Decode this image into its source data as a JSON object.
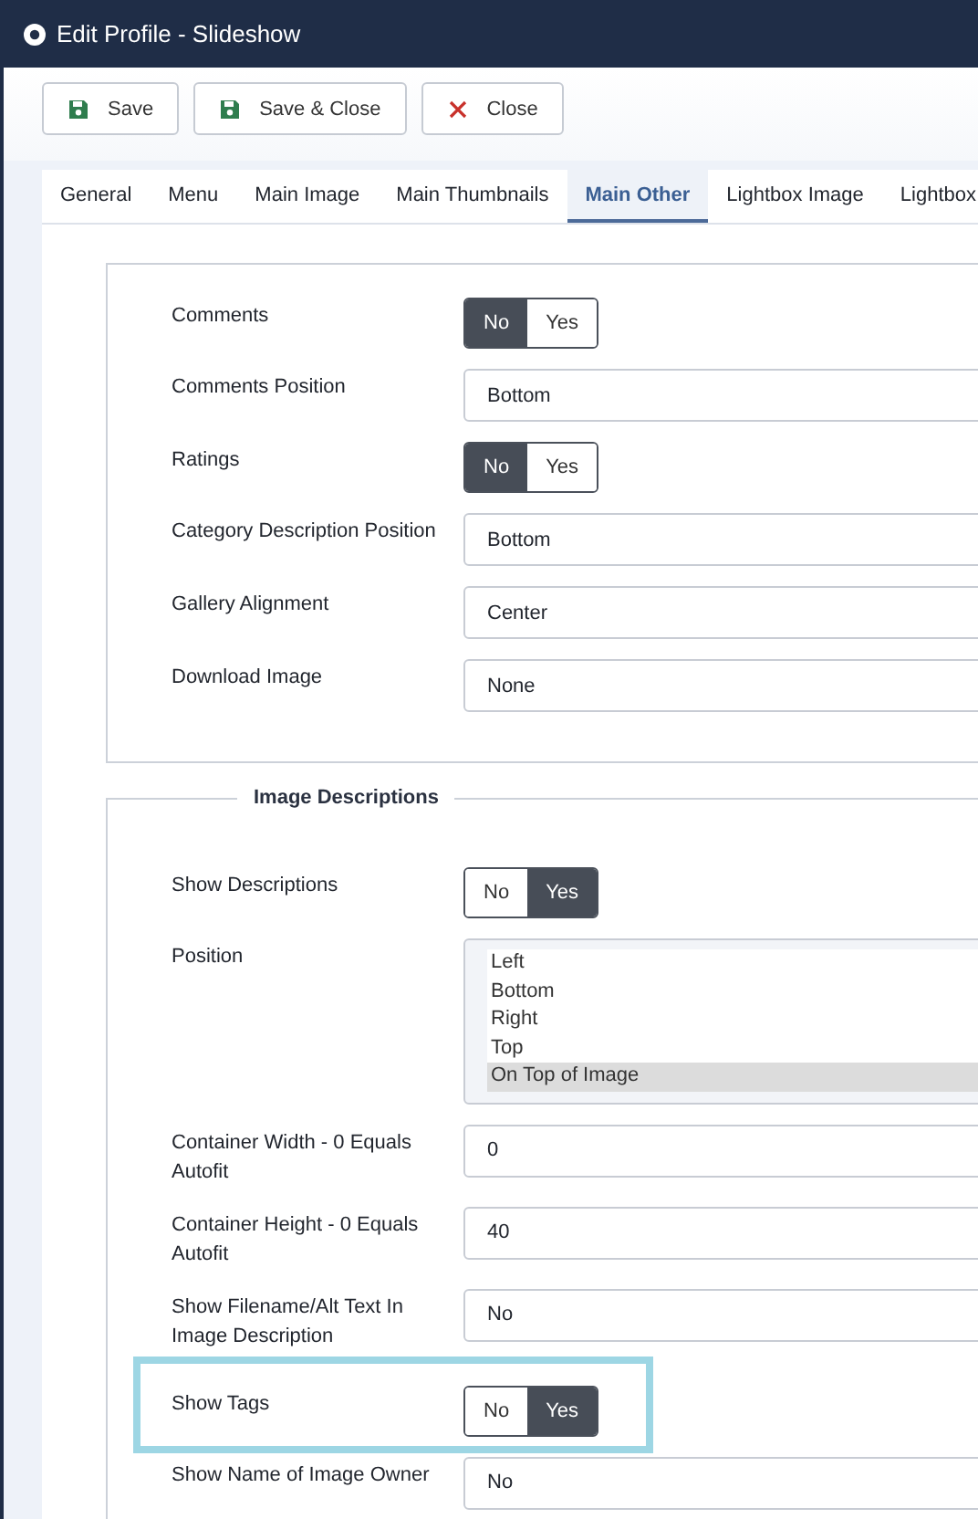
{
  "window": {
    "title": "Edit Profile - Slideshow"
  },
  "toolbar": [
    {
      "label": "Save",
      "kind": "save"
    },
    {
      "label": "Save & Close",
      "kind": "save"
    },
    {
      "label": "Close",
      "kind": "close"
    }
  ],
  "tabs": [
    {
      "label": "General",
      "selected": false
    },
    {
      "label": "Menu",
      "selected": false
    },
    {
      "label": "Main Image",
      "selected": false
    },
    {
      "label": "Main Thumbnails",
      "selected": false
    },
    {
      "label": "Main Other",
      "selected": true
    },
    {
      "label": "Lightbox Image",
      "selected": false
    },
    {
      "label": "Lightbox",
      "selected": false
    }
  ],
  "sections": [
    {
      "fields": [
        {
          "label": "Comments",
          "kind": "toggle",
          "options": [
            {
              "label": "No",
              "selected": true
            },
            {
              "label": "Yes",
              "selected": false
            }
          ]
        },
        {
          "label": "Comments Position",
          "kind": "select",
          "value": "Bottom"
        },
        {
          "label": "Ratings",
          "kind": "toggle",
          "options": [
            {
              "label": "No",
              "selected": true
            },
            {
              "label": "Yes",
              "selected": false
            }
          ]
        },
        {
          "label": "Category Description Position",
          "kind": "select",
          "value": "Bottom"
        },
        {
          "label": "Gallery Alignment",
          "kind": "select",
          "value": "Center"
        },
        {
          "label": "Download Image",
          "kind": "select",
          "value": "None"
        }
      ]
    },
    {
      "legend": "Image Descriptions",
      "fields": [
        {
          "label": "Show Descriptions",
          "kind": "toggle",
          "options": [
            {
              "label": "No",
              "selected": false
            },
            {
              "label": "Yes",
              "selected": true
            }
          ]
        },
        {
          "label": "Position",
          "kind": "listbox",
          "options": [
            {
              "label": "Left",
              "selected": false
            },
            {
              "label": "Bottom",
              "selected": false
            },
            {
              "label": "Right",
              "selected": false
            },
            {
              "label": "Top",
              "selected": false
            },
            {
              "label": "On Top of Image",
              "selected": true
            }
          ]
        },
        {
          "label": "Container Width - 0 Equals Autofit",
          "kind": "text",
          "value": "0"
        },
        {
          "label": "Container Height - 0 Equals Autofit",
          "kind": "text",
          "value": "40"
        },
        {
          "label": "Show Filename/Alt Text In Image Description",
          "kind": "select",
          "value": "No"
        },
        {
          "label": "Show Tags",
          "kind": "toggle",
          "highlighted": true,
          "options": [
            {
              "label": "No",
              "selected": false
            },
            {
              "label": "Yes",
              "selected": true
            }
          ]
        },
        {
          "label": "Show Name of Image Owner",
          "kind": "select",
          "value": "No"
        }
      ]
    }
  ]
}
